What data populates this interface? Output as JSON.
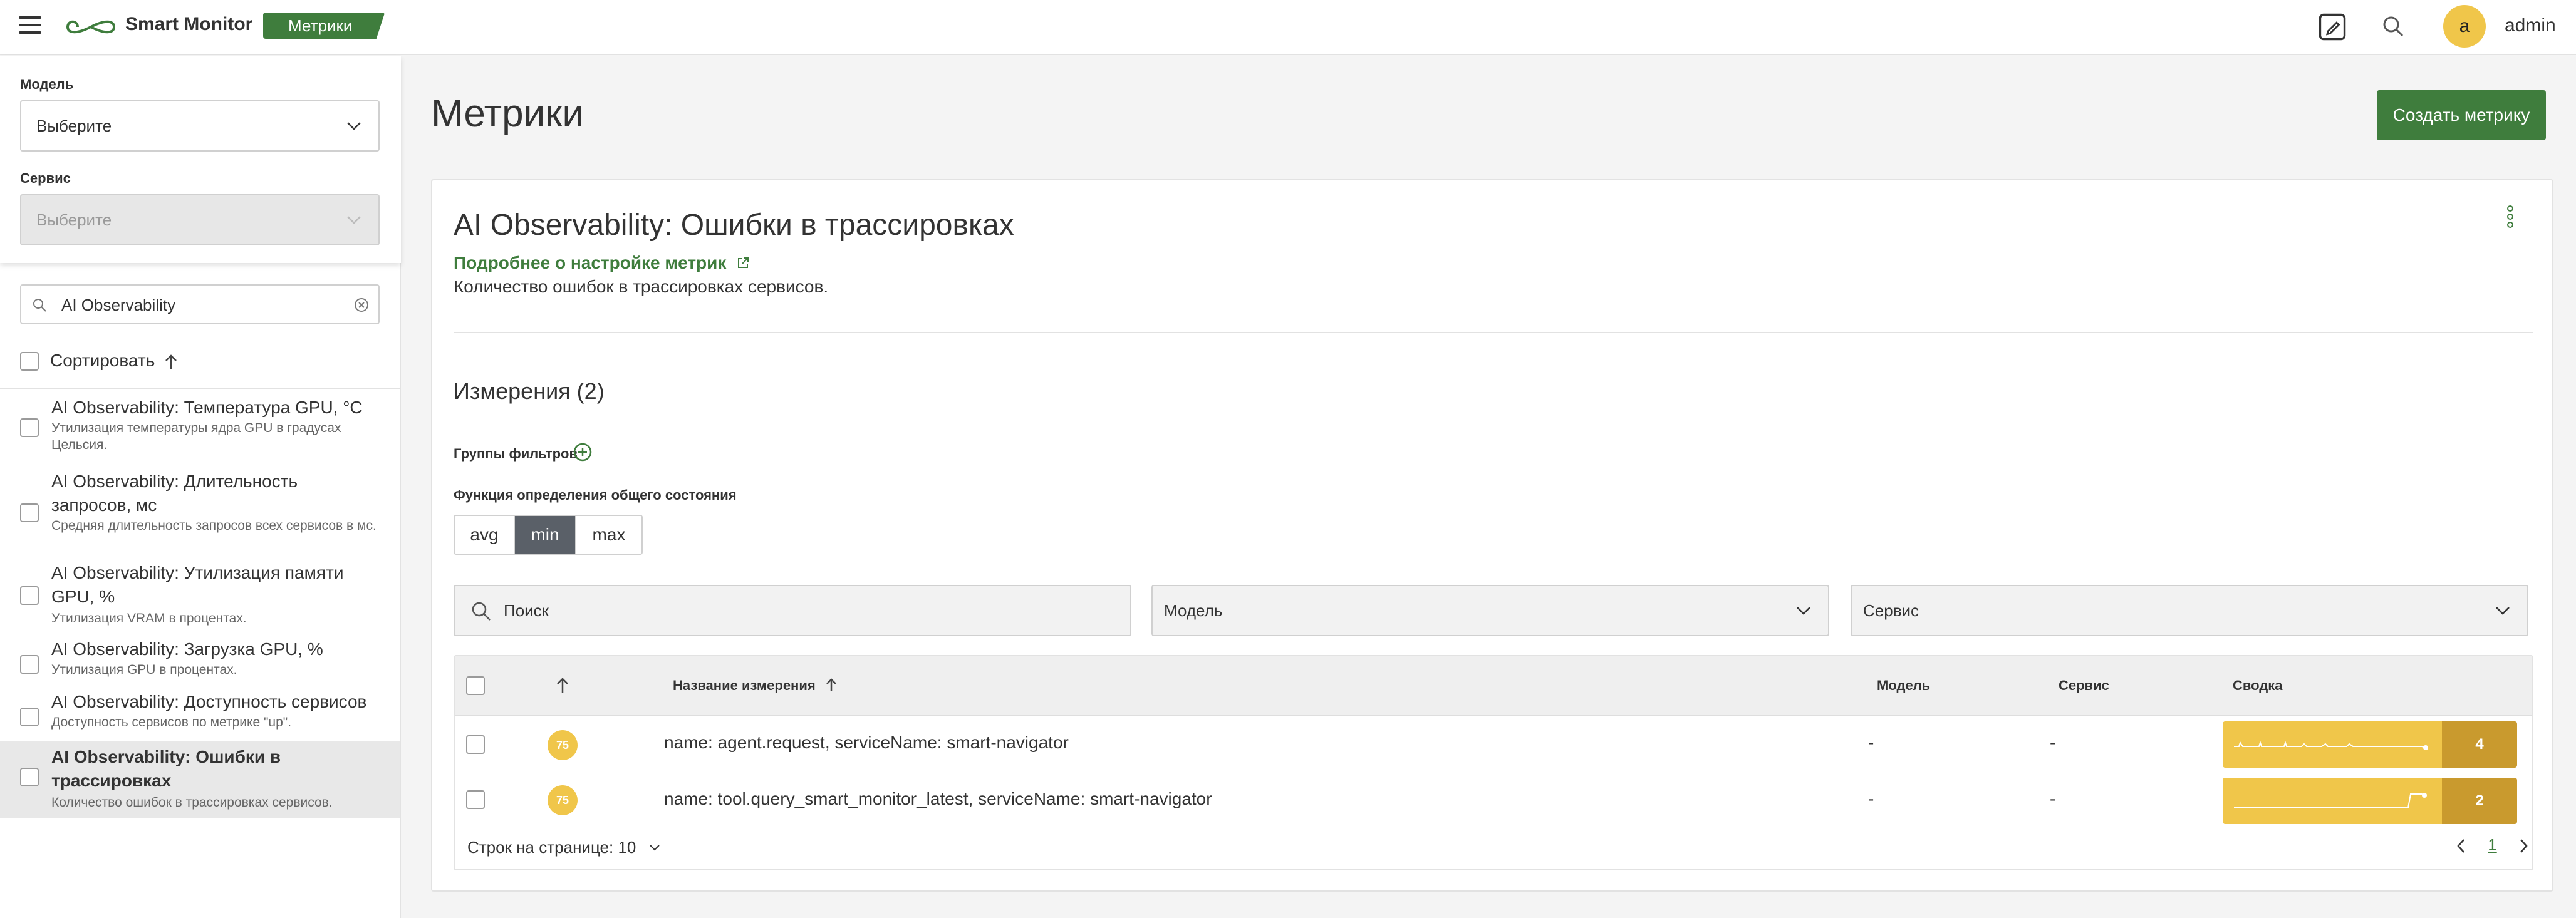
{
  "topbar": {
    "brand": "Smart Monitor",
    "section_badge": "Метрики",
    "user_initial": "a",
    "user_name": "admin"
  },
  "sidebar": {
    "model_label": "Модель",
    "model_value": "Выберите",
    "service_label": "Сервис",
    "service_value": "Выберите",
    "search_value": "AI Observability",
    "sort_label": "Сортировать",
    "items": [
      {
        "title": "AI Observability: Температура GPU, °C",
        "desc": "Утилизация температуры ядра GPU в градусах Цельсия."
      },
      {
        "title": "AI Observability: Длительность запросов, мс",
        "desc": "Средняя длительность запросов всех сервисов в мс."
      },
      {
        "title": "AI Observability: Утилизация памяти GPU, %",
        "desc": "Утилизация VRAM в процентах."
      },
      {
        "title": "AI Observability: Загрузка GPU, %",
        "desc": "Утилизация GPU в процентах."
      },
      {
        "title": "AI Observability: Доступность сервисов",
        "desc": "Доступность сервисов по метрике \"up\"."
      },
      {
        "title": "AI Observability: Ошибки в трассировках",
        "desc": "Количество ошибок в трассировках сервисов."
      }
    ]
  },
  "main": {
    "page_title": "Метрики",
    "create_button": "Создать метрику",
    "card": {
      "title": "AI Observability: Ошибки в трассировках",
      "doc_link": "Подробнее о настройке метрик",
      "description": "Количество ошибок в трассировках сервисов.",
      "dimensions_title": "Измерения (2)",
      "filter_groups_label": "Группы фильтров",
      "state_function_label": "Функция определения общего состояния",
      "functions": [
        "avg",
        "min",
        "max"
      ],
      "active_function": "min",
      "search_placeholder": "Поиск",
      "model_select": "Модель",
      "service_select": "Сервис",
      "table": {
        "col_name": "Название измерения",
        "col_model": "Модель",
        "col_service": "Сервис",
        "col_summary": "Сводка",
        "rows": [
          {
            "badge": "75",
            "name": "name: agent.request, serviceName: smart-navigator",
            "model": "-",
            "service": "-",
            "summary": "4"
          },
          {
            "badge": "75",
            "name": "name: tool.query_smart_monitor_latest, serviceName: smart-navigator",
            "model": "-",
            "service": "-",
            "summary": "2"
          }
        ],
        "rows_per_page": "Строк на странице: 10",
        "current_page": "1"
      }
    }
  },
  "colors": {
    "accent_green": "#3f7d3d",
    "badge_yellow": "#f0c64a",
    "summary_dark": "#c99a2e",
    "segment_active": "#5a6068"
  }
}
